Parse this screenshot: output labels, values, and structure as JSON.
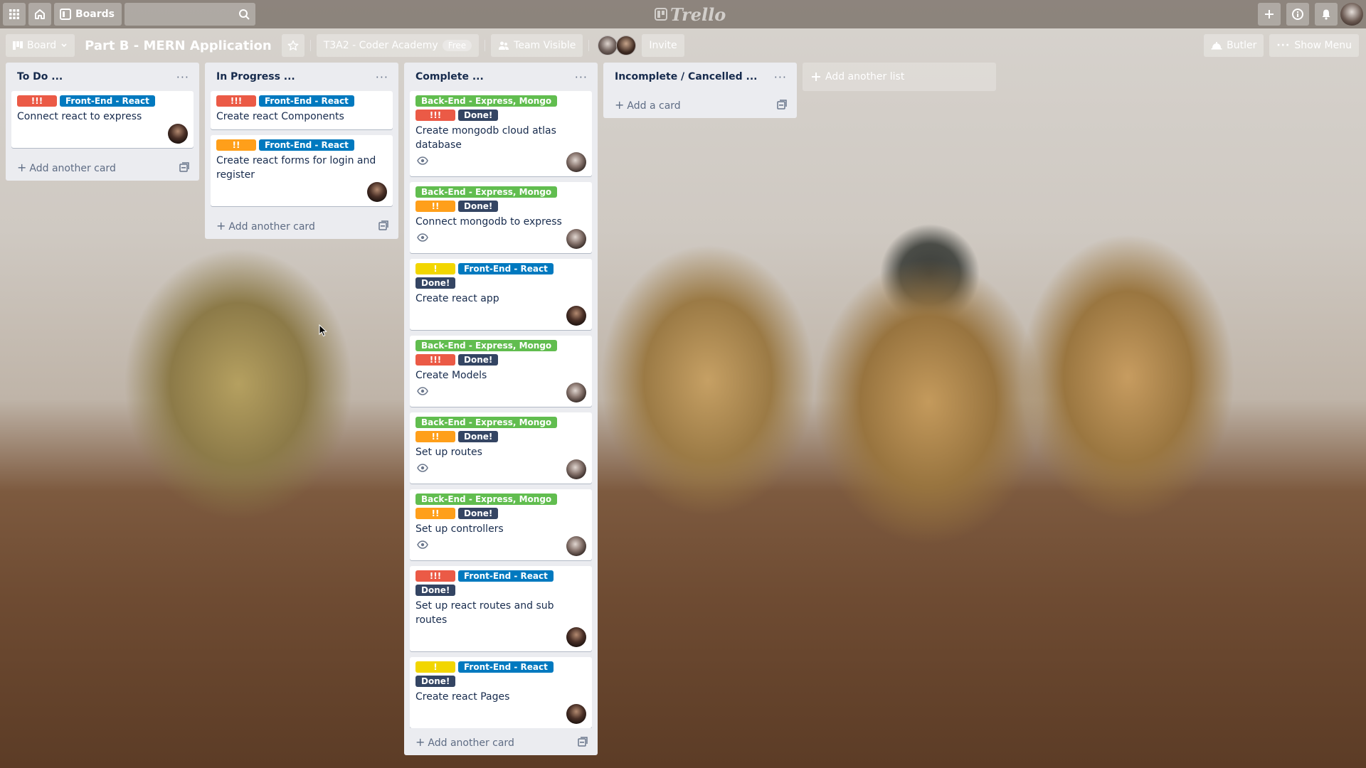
{
  "header": {
    "boards_label": "Boards",
    "search_placeholder": "",
    "logo_text": "Trello"
  },
  "board": {
    "view_label": "Board",
    "title": "Part B - MERN Application",
    "team_name": "T3A2 - Coder Academy",
    "team_badge": "Free",
    "visibility_label": "Team Visible",
    "invite_label": "Invite",
    "butler_label": "Butler",
    "show_menu_label": "Show Menu",
    "add_list_label": "Add another list"
  },
  "colors": {
    "red": "#eb5a46",
    "orange": "#ff9f1a",
    "yellow": "#f2d600",
    "green": "#61bd4f",
    "blue": "#0079bf",
    "dark": "#344563"
  },
  "lists": [
    {
      "title": "To Do ...",
      "add_label": "Add another card",
      "cards": [
        {
          "labels": [
            {
              "text": "!!!",
              "color": "red"
            },
            {
              "text": "Front-End - React",
              "color": "blue"
            }
          ],
          "title": "Connect react to express",
          "watch": false,
          "avatar": "a"
        }
      ]
    },
    {
      "title": "In Progress ...",
      "add_label": "Add another card",
      "cards": [
        {
          "labels": [
            {
              "text": "!!!",
              "color": "red"
            },
            {
              "text": "Front-End - React",
              "color": "blue"
            }
          ],
          "title": "Create react Components",
          "watch": false,
          "avatar": ""
        },
        {
          "labels": [
            {
              "text": "!!",
              "color": "orange"
            },
            {
              "text": "Front-End - React",
              "color": "blue"
            }
          ],
          "title": "Create react forms for login and register",
          "watch": false,
          "avatar": "a"
        }
      ]
    },
    {
      "title": "Complete ...",
      "add_label": "Add another card",
      "cards": [
        {
          "labels": [
            {
              "text": "Back-End - Express, Mongo",
              "color": "green"
            },
            {
              "text": "!!!",
              "color": "red"
            },
            {
              "text": "Done!",
              "color": "dark"
            }
          ],
          "title": "Create mongodb cloud atlas database",
          "watch": true,
          "avatar": "b"
        },
        {
          "labels": [
            {
              "text": "Back-End - Express, Mongo",
              "color": "green"
            },
            {
              "text": "!!",
              "color": "orange"
            },
            {
              "text": "Done!",
              "color": "dark"
            }
          ],
          "title": "Connect mongodb to express",
          "watch": true,
          "avatar": "b"
        },
        {
          "labels": [
            {
              "text": "!",
              "color": "yellow"
            },
            {
              "text": "Front-End - React",
              "color": "blue"
            },
            {
              "text": "Done!",
              "color": "dark"
            }
          ],
          "title": "Create react app",
          "watch": false,
          "avatar": "a"
        },
        {
          "labels": [
            {
              "text": "Back-End - Express, Mongo",
              "color": "green"
            },
            {
              "text": "!!!",
              "color": "red"
            },
            {
              "text": "Done!",
              "color": "dark"
            }
          ],
          "title": "Create Models",
          "watch": true,
          "avatar": "b"
        },
        {
          "labels": [
            {
              "text": "Back-End - Express, Mongo",
              "color": "green"
            },
            {
              "text": "!!",
              "color": "orange"
            },
            {
              "text": "Done!",
              "color": "dark"
            }
          ],
          "title": "Set up routes",
          "watch": true,
          "avatar": "b"
        },
        {
          "labels": [
            {
              "text": "Back-End - Express, Mongo",
              "color": "green"
            },
            {
              "text": "!!",
              "color": "orange"
            },
            {
              "text": "Done!",
              "color": "dark"
            }
          ],
          "title": "Set up controllers",
          "watch": true,
          "avatar": "b"
        },
        {
          "labels": [
            {
              "text": "!!!",
              "color": "red"
            },
            {
              "text": "Front-End - React",
              "color": "blue"
            },
            {
              "text": "Done!",
              "color": "dark"
            }
          ],
          "title": "Set up react routes and sub routes",
          "watch": false,
          "avatar": "a"
        },
        {
          "labels": [
            {
              "text": "!",
              "color": "yellow"
            },
            {
              "text": "Front-End - React",
              "color": "blue"
            },
            {
              "text": "Done!",
              "color": "dark"
            }
          ],
          "title": "Create react Pages",
          "watch": false,
          "avatar": "a"
        }
      ]
    },
    {
      "title": "Incomplete / Cancelled ...",
      "add_label": "Add a card",
      "cards": []
    }
  ]
}
